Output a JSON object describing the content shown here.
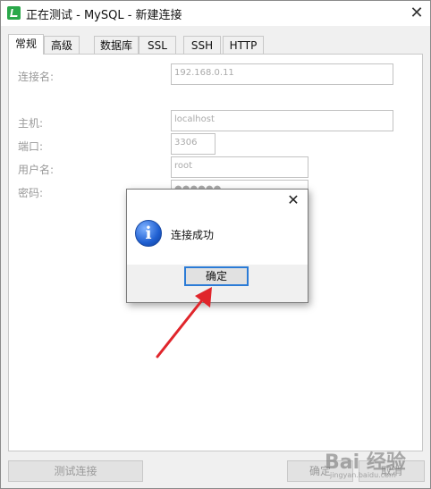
{
  "window": {
    "title": "正在测试 - MySQL - 新建连接",
    "close_glyph": "✕"
  },
  "tabs": [
    {
      "label": "常规",
      "active": true
    },
    {
      "label": "高级",
      "active": false
    },
    {
      "label": "数据库",
      "active": false
    },
    {
      "label": "SSL",
      "active": false
    },
    {
      "label": "SSH",
      "active": false
    },
    {
      "label": "HTTP",
      "active": false
    }
  ],
  "form": {
    "connection_name": {
      "label": "连接名:",
      "value": "192.168.0.11"
    },
    "host": {
      "label": "主机:",
      "value": "localhost"
    },
    "port": {
      "label": "端口:",
      "value": "3306"
    },
    "username": {
      "label": "用户名:",
      "value": "root"
    },
    "password": {
      "label": "密码:",
      "value": "●●●●●●"
    }
  },
  "buttons": {
    "test_connection": "测试连接",
    "ok": "确定",
    "cancel": "取消"
  },
  "dialog": {
    "message": "连接成功",
    "ok_label": "确定",
    "close_glyph": "✕",
    "icon": "info-icon",
    "icon_glyph": "i"
  },
  "watermark": {
    "text": "Bai 经验",
    "sub": "jingyan.baidu.com"
  },
  "colors": {
    "accent": "#2b7bd6",
    "arrow": "#e0252b"
  }
}
